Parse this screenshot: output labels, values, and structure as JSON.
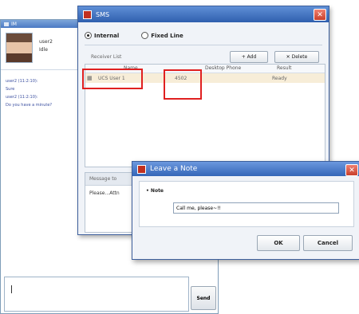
{
  "chat": {
    "title": "IM",
    "profile_name": "user2",
    "profile_status": "Idle",
    "messages": [
      "user2 (11:2:10):",
      "Sure",
      "user2 (11:2:10):",
      "Do you have a minute?"
    ],
    "send_label": "Send"
  },
  "sms": {
    "title": "SMS",
    "radio_internal": "Internal",
    "radio_fixed": "Fixed Line",
    "receiver_list_label": "Receiver List",
    "add_label": "+ Add",
    "delete_label": "✕ Delete",
    "col_name": "Name",
    "col_desk": "Desktop Phone",
    "col_result": "Result",
    "row_name": "UCS User 1",
    "row_phone": "4502",
    "row_result": "Ready",
    "msg_tab": "Message to",
    "msg_text": "Please...Attn"
  },
  "note": {
    "title": "Leave a Note",
    "label": "• Note",
    "input_value": "Call me, please~!!",
    "ok_label": "OK",
    "cancel_label": "Cancel"
  }
}
